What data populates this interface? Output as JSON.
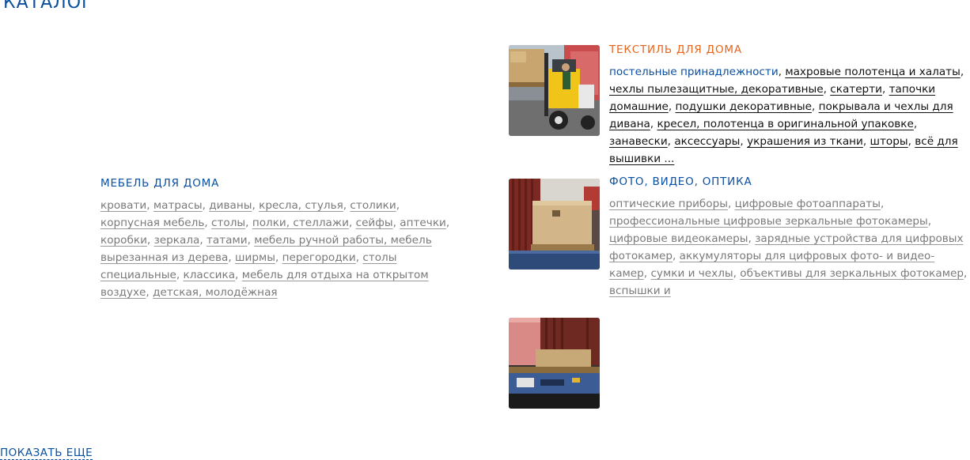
{
  "catalog": {
    "title": "КАТАЛОГ",
    "show_more": "ПОКАЗАТЬ ЕЩЕ",
    "categories": [
      {
        "title": "ТЕКСТИЛЬ ДЛЯ ДОМА",
        "title_color": "#e8641b",
        "image": "forklift-loading-boxes-photo",
        "links": [
          "постельные принадлежности",
          "махровые полотенца и халаты",
          "чехлы пылезащитные, декоративные",
          "скатерти",
          "тапочки домашние",
          "подушки декоративные",
          "покрывала и чехлы для дивана",
          "кресел, полотенца в оригинальной упаковке",
          "занавески",
          "аксессуары",
          "украшения из ткани",
          "шторы",
          "всё для вышивки ..."
        ]
      },
      {
        "title": "МЕБЕЛЬ ДЛЯ ДОМА",
        "title_color": "#0b4fa0",
        "links": [
          "кровати",
          "матрасы",
          "диваны",
          "кресла, стулья",
          "столики",
          "корпусная мебель",
          "столы",
          "полки, стеллажи",
          "сейфы",
          "аптечки",
          "коробки",
          "зеркала",
          "татами",
          "мебель ручной работы, мебель вырезанная из дерева",
          "ширмы",
          "перегородки",
          "столы специальные",
          "классика",
          "мебель для отдыха на открытом воздухе",
          "детская, молодёжная"
        ]
      },
      {
        "title": "ФОТО, ВИДЕО, ОПТИКА",
        "title_color": "#0b4fa0",
        "image": "pallet-box-container-photo",
        "links": [
          "оптические приборы",
          "цифровые фотоаппараты",
          "профессиональные цифровые зеркальные фотокамеры",
          "цифровые видеокамеры",
          "зарядные устройства для цифровых фотокамер",
          "аккумуляторы для цифровых фото- и видео- камер",
          "сумки и чехлы",
          "объективы для зеркальных фотокамер",
          "вспышки и"
        ]
      },
      {
        "image": "truck-container-photo"
      }
    ]
  },
  "colors": {
    "accent_blue": "#0b4fa0",
    "accent_orange": "#e8641b",
    "link_gray": "#7a7a7a"
  }
}
